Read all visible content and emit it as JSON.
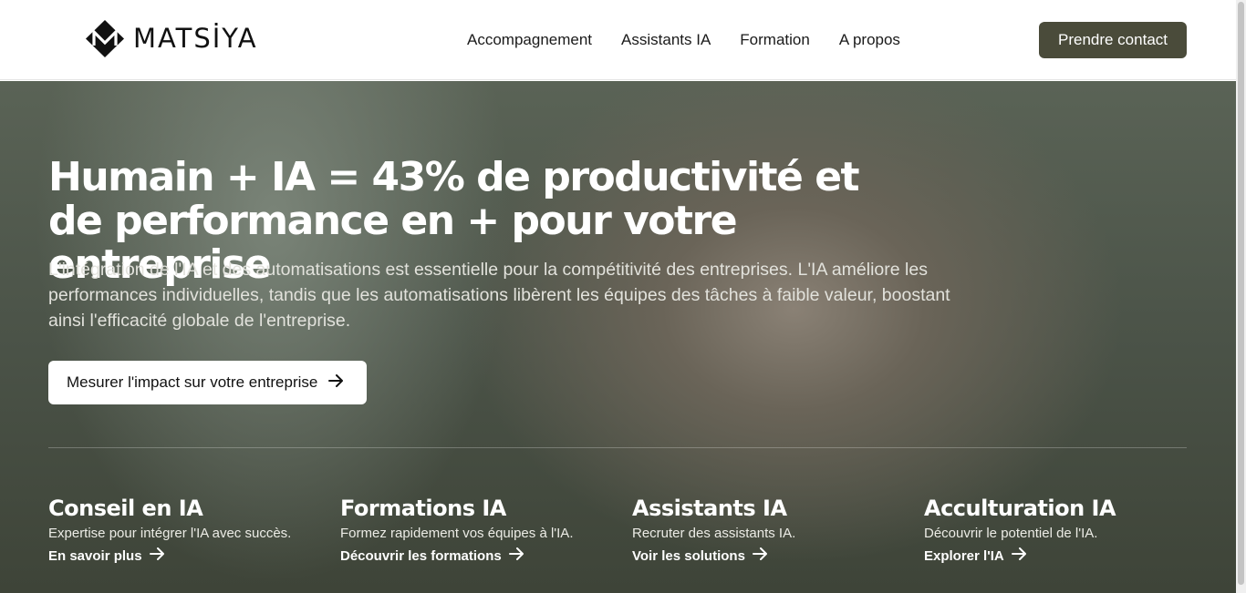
{
  "brand": {
    "name": "MATSİYA",
    "logo_icon": "matsiya-m-diamond-logo"
  },
  "nav": {
    "items": [
      {
        "label": "Accompagnement"
      },
      {
        "label": "Assistants IA"
      },
      {
        "label": "Formation"
      },
      {
        "label": "A propos"
      }
    ],
    "contact_label": "Prendre contact"
  },
  "hero": {
    "title": "Humain + IA = 43% de productivité et de performance en + pour votre entreprise",
    "subtitle": "L'intégration de l'IA et des automatisations est essentielle pour la compétitivité des entreprises. L'IA améliore les performances individuelles, tandis que les automatisations libèrent les équipes des tâches à faible valeur, boostant ainsi l'efficacité globale de l'entreprise.",
    "cta_label": "Mesurer l'impact sur votre entreprise",
    "cta_icon": "arrow-right-icon"
  },
  "services": [
    {
      "title": "Conseil en IA",
      "description": "Expertise pour intégrer l'IA avec succès.",
      "link": "En savoir plus"
    },
    {
      "title": "Formations IA",
      "description": "Formez rapidement vos équipes à l'IA.",
      "link": "Découvrir les formations"
    },
    {
      "title": "Assistants IA",
      "description": "Recruter des assistants IA.",
      "link": "Voir les solutions"
    },
    {
      "title": "Acculturation IA",
      "description": "Découvrir le potentiel de l'IA.",
      "link": "Explorer l'IA"
    }
  ],
  "colors": {
    "accent": "#4a4b3a",
    "hero_overlay": "#4b5348",
    "text_light": "#ffffff"
  }
}
